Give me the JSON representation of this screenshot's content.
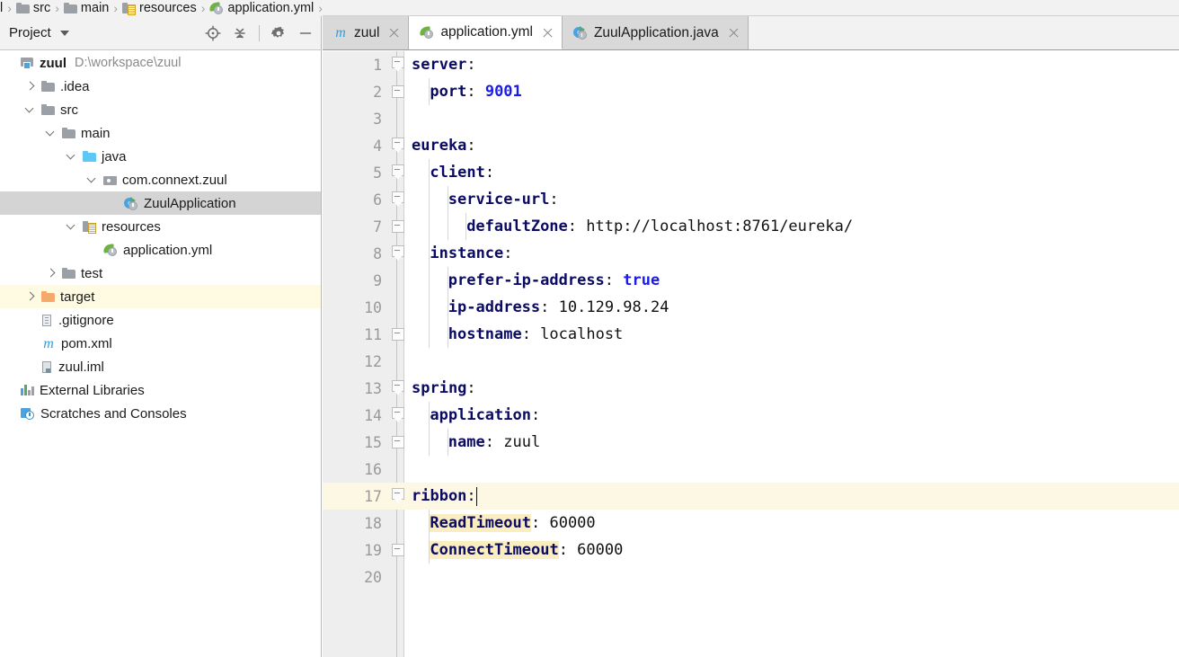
{
  "breadcrumb": {
    "name": "breadcrumb",
    "items": [
      {
        "label": "l",
        "icon": "none"
      },
      {
        "label": "src",
        "icon": "folder-gray"
      },
      {
        "label": "main",
        "icon": "folder-gray"
      },
      {
        "label": "resources",
        "icon": "folder-resources"
      },
      {
        "label": "application.yml",
        "icon": "spring-leaf"
      }
    ]
  },
  "panel": {
    "title": "Project",
    "tools": [
      {
        "name": "locate-icon",
        "label": "Select Opened File"
      },
      {
        "name": "collapse-all-icon",
        "label": "Collapse All"
      },
      {
        "name": "gear-icon",
        "label": "Settings"
      },
      {
        "name": "minimize-icon",
        "label": "Hide"
      }
    ],
    "tree": [
      {
        "label": "zuul",
        "path": "D:\\workspace\\zuul",
        "indent": 0,
        "arrow": "none",
        "icon": "module",
        "bold": true,
        "state": "normal"
      },
      {
        "label": ".idea",
        "path": "",
        "indent": 1,
        "arrow": "right",
        "icon": "folder-gray",
        "bold": false,
        "state": "normal"
      },
      {
        "label": "src",
        "path": "",
        "indent": 1,
        "arrow": "down",
        "icon": "folder-gray",
        "bold": false,
        "state": "normal"
      },
      {
        "label": "main",
        "path": "",
        "indent": 2,
        "arrow": "down",
        "icon": "folder-gray",
        "bold": false,
        "state": "normal"
      },
      {
        "label": "java",
        "path": "",
        "indent": 3,
        "arrow": "down",
        "icon": "folder-blue",
        "bold": false,
        "state": "normal"
      },
      {
        "label": "com.connext.zuul",
        "path": "",
        "indent": 4,
        "arrow": "down",
        "icon": "package",
        "bold": false,
        "state": "normal"
      },
      {
        "label": "ZuulApplication",
        "path": "",
        "indent": 5,
        "arrow": "none",
        "icon": "java-class-run",
        "bold": false,
        "state": "selected"
      },
      {
        "label": "resources",
        "path": "",
        "indent": 3,
        "arrow": "down",
        "icon": "folder-resources",
        "bold": false,
        "state": "normal"
      },
      {
        "label": "application.yml",
        "path": "",
        "indent": 4,
        "arrow": "none",
        "icon": "spring-leaf",
        "bold": false,
        "state": "normal"
      },
      {
        "label": "test",
        "path": "",
        "indent": 2,
        "arrow": "right",
        "icon": "folder-gray",
        "bold": false,
        "state": "normal"
      },
      {
        "label": "target",
        "path": "",
        "indent": 1,
        "arrow": "right",
        "icon": "folder-orange",
        "bold": false,
        "state": "excluded"
      },
      {
        "label": ".gitignore",
        "path": "",
        "indent": 1,
        "arrow": "none",
        "icon": "file",
        "bold": false,
        "state": "normal"
      },
      {
        "label": "pom.xml",
        "path": "",
        "indent": 1,
        "arrow": "none",
        "icon": "maven",
        "bold": false,
        "state": "normal"
      },
      {
        "label": "zuul.iml",
        "path": "",
        "indent": 1,
        "arrow": "none",
        "icon": "iml",
        "bold": false,
        "state": "normal"
      },
      {
        "label": "External Libraries",
        "path": "",
        "indent": 0,
        "arrow": "none",
        "icon": "library",
        "bold": false,
        "state": "normal"
      },
      {
        "label": "Scratches and Consoles",
        "path": "",
        "indent": 0,
        "arrow": "none",
        "icon": "scratch",
        "bold": false,
        "state": "normal"
      }
    ]
  },
  "editor": {
    "tabs": [
      {
        "label": "zuul",
        "icon": "maven",
        "active": false
      },
      {
        "label": "application.yml",
        "icon": "spring-leaf",
        "active": true
      },
      {
        "label": "ZuulApplication.java",
        "icon": "java-class-run",
        "active": false
      }
    ],
    "current_line": 17,
    "caret_line": 17,
    "lines": [
      {
        "n": 1,
        "fold": "shield",
        "indent": 0,
        "tokens": [
          {
            "t": "server",
            "c": "k"
          },
          {
            "t": ":",
            "c": "p"
          }
        ]
      },
      {
        "n": 2,
        "fold": "square",
        "indent": 1,
        "tokens": [
          {
            "t": "port",
            "c": "k"
          },
          {
            "t": ": ",
            "c": "p"
          },
          {
            "t": "9001",
            "c": "nv"
          }
        ]
      },
      {
        "n": 3,
        "fold": "none",
        "indent": 0,
        "tokens": []
      },
      {
        "n": 4,
        "fold": "shield",
        "indent": 0,
        "tokens": [
          {
            "t": "eureka",
            "c": "k"
          },
          {
            "t": ":",
            "c": "p"
          }
        ]
      },
      {
        "n": 5,
        "fold": "shield",
        "indent": 1,
        "tokens": [
          {
            "t": "client",
            "c": "k"
          },
          {
            "t": ":",
            "c": "p"
          }
        ]
      },
      {
        "n": 6,
        "fold": "shield",
        "indent": 2,
        "tokens": [
          {
            "t": "service-url",
            "c": "k"
          },
          {
            "t": ":",
            "c": "p"
          }
        ]
      },
      {
        "n": 7,
        "fold": "square",
        "indent": 3,
        "tokens": [
          {
            "t": "defaultZone",
            "c": "k"
          },
          {
            "t": ": ",
            "c": "p"
          },
          {
            "t": "http://localhost:8761/eureka/",
            "c": "v"
          }
        ]
      },
      {
        "n": 8,
        "fold": "shield",
        "indent": 1,
        "tokens": [
          {
            "t": "instance",
            "c": "k"
          },
          {
            "t": ":",
            "c": "p"
          }
        ]
      },
      {
        "n": 9,
        "fold": "none",
        "indent": 2,
        "tokens": [
          {
            "t": "prefer-ip-address",
            "c": "k"
          },
          {
            "t": ": ",
            "c": "p"
          },
          {
            "t": "true",
            "c": "nv"
          }
        ]
      },
      {
        "n": 10,
        "fold": "none",
        "indent": 2,
        "tokens": [
          {
            "t": "ip-address",
            "c": "k"
          },
          {
            "t": ": ",
            "c": "p"
          },
          {
            "t": "10.129.98.24",
            "c": "v"
          }
        ]
      },
      {
        "n": 11,
        "fold": "square",
        "indent": 2,
        "tokens": [
          {
            "t": "hostname",
            "c": "k"
          },
          {
            "t": ": ",
            "c": "p"
          },
          {
            "t": "localhost",
            "c": "v"
          }
        ]
      },
      {
        "n": 12,
        "fold": "none",
        "indent": 0,
        "tokens": []
      },
      {
        "n": 13,
        "fold": "shield",
        "indent": 0,
        "tokens": [
          {
            "t": "spring",
            "c": "k"
          },
          {
            "t": ":",
            "c": "p"
          }
        ]
      },
      {
        "n": 14,
        "fold": "shield",
        "indent": 1,
        "tokens": [
          {
            "t": "application",
            "c": "k"
          },
          {
            "t": ":",
            "c": "p"
          }
        ]
      },
      {
        "n": 15,
        "fold": "square",
        "indent": 2,
        "tokens": [
          {
            "t": "name",
            "c": "k"
          },
          {
            "t": ": ",
            "c": "p"
          },
          {
            "t": "zuul",
            "c": "v"
          }
        ]
      },
      {
        "n": 16,
        "fold": "none",
        "indent": 0,
        "tokens": []
      },
      {
        "n": 17,
        "fold": "shield",
        "indent": 0,
        "tokens": [
          {
            "t": "ribbon",
            "c": "k"
          },
          {
            "t": ":",
            "c": "p"
          }
        ],
        "caret": true
      },
      {
        "n": 18,
        "fold": "none",
        "indent": 1,
        "tokens": [
          {
            "t": "ReadTimeout",
            "c": "kh"
          },
          {
            "t": ": ",
            "c": "p"
          },
          {
            "t": "60000",
            "c": "v"
          }
        ]
      },
      {
        "n": 19,
        "fold": "square",
        "indent": 1,
        "tokens": [
          {
            "t": "ConnectTimeout",
            "c": "kh"
          },
          {
            "t": ": ",
            "c": "p"
          },
          {
            "t": "60000",
            "c": "v"
          }
        ]
      },
      {
        "n": 20,
        "fold": "none",
        "indent": 0,
        "tokens": []
      }
    ]
  },
  "colors": {
    "key": "#0b0b63",
    "number": "#1a1aee",
    "value": "#111111",
    "current_line_bg": "#fdf8e3",
    "identifier_highlight_bg": "#faeec0",
    "selected_row_bg": "#d4d4d4",
    "excluded_row_bg": "#fffbe2",
    "gutter_bg": "#eeeeee",
    "panel_header_bg": "#f2f2f2"
  }
}
